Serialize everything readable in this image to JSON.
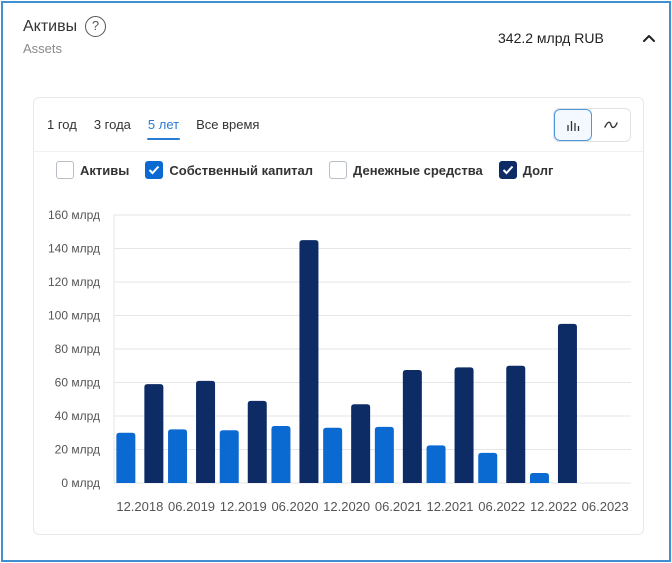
{
  "header": {
    "title": "Активы",
    "subtitle": "Assets",
    "value": "342.2 млрд RUB",
    "help_symbol": "?"
  },
  "tabs": [
    {
      "label": "1 год",
      "active": false
    },
    {
      "label": "3 года",
      "active": false
    },
    {
      "label": "5 лет",
      "active": true
    },
    {
      "label": "Все время",
      "active": false
    }
  ],
  "view_toggle": {
    "options": [
      "bar-chart-icon",
      "line-chart-icon"
    ],
    "active": "bar-chart-icon"
  },
  "legend": [
    {
      "label": "Активы",
      "checked": false,
      "color": "#b9bec6"
    },
    {
      "label": "Собственный капитал",
      "checked": true,
      "color": "#0b6ad2"
    },
    {
      "label": "Денежные средства",
      "checked": false,
      "color": "#b9bec6"
    },
    {
      "label": "Долг",
      "checked": true,
      "color": "#0d2c66"
    }
  ],
  "colors": {
    "equity": "#0b6ad2",
    "debt": "#0d2c66",
    "accent": "#2a7bd4",
    "frame": "#3f8fd1"
  },
  "chart_data": {
    "type": "bar",
    "categories": [
      "12.2018",
      "06.2019",
      "12.2019",
      "06.2020",
      "12.2020",
      "06.2021",
      "12.2021",
      "06.2022",
      "12.2022",
      "06.2023"
    ],
    "series": [
      {
        "name": "Собственный капитал",
        "values": [
          30,
          32,
          31.5,
          34,
          33,
          33.5,
          22.5,
          18,
          6,
          0
        ]
      },
      {
        "name": "Долг",
        "values": [
          59,
          61,
          49,
          145,
          47,
          67.5,
          69,
          70,
          95,
          0
        ]
      }
    ],
    "ylim": [
      0,
      160
    ],
    "yticks": [
      "0 млрд",
      "20 млрд",
      "40 млрд",
      "60 млрд",
      "80 млрд",
      "100 млрд",
      "120 млрд",
      "140 млрд",
      "160 млрд"
    ],
    "grid": true
  }
}
